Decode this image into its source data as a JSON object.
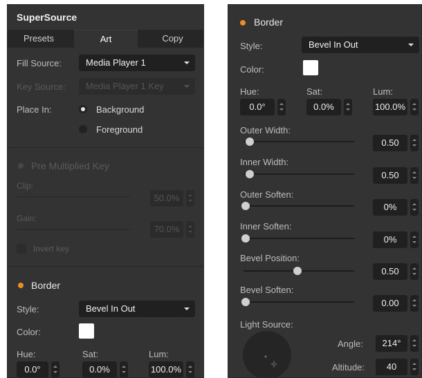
{
  "left_panel": {
    "title": "SuperSource",
    "tabs": [
      "Presets",
      "Art",
      "Copy"
    ],
    "active_tab": "Art",
    "fill_source": {
      "label": "Fill Source:",
      "value": "Media Player 1"
    },
    "key_source": {
      "label": "Key Source:",
      "value": "Media Player 1 Key"
    },
    "place_in": {
      "label": "Place In:",
      "options": [
        "Background",
        "Foreground"
      ],
      "selected": "Background"
    },
    "pre_multiplied_key": {
      "title": "Pre Multiplied Key",
      "clip": {
        "label": "Clip:",
        "value": "50.0%",
        "level": 0.5
      },
      "gain": {
        "label": "Gain:",
        "value": "70.0%",
        "level": 0.7
      },
      "invert_key": "Invert key"
    },
    "border": {
      "title": "Border",
      "style": {
        "label": "Style:",
        "value": "Bevel In Out"
      },
      "color": {
        "label": "Color:",
        "swatch": "#ffffff"
      },
      "hue": {
        "label": "Hue:",
        "value": "0.0°"
      },
      "sat": {
        "label": "Sat:",
        "value": "0.0%"
      },
      "lum": {
        "label": "Lum:",
        "value": "100.0%"
      }
    }
  },
  "right_panel": {
    "border": {
      "title": "Border",
      "style": {
        "label": "Style:",
        "value": "Bevel In Out"
      },
      "color": {
        "label": "Color:",
        "swatch": "#ffffff"
      },
      "hue": {
        "label": "Hue:",
        "value": "0.0°"
      },
      "sat": {
        "label": "Sat:",
        "value": "0.0%"
      },
      "lum": {
        "label": "Lum:",
        "value": "100.0%"
      },
      "outer_width": {
        "label": "Outer Width:",
        "value": "0.50",
        "level": 0.05
      },
      "inner_width": {
        "label": "Inner Width:",
        "value": "0.50",
        "level": 0.05
      },
      "outer_soften": {
        "label": "Outer Soften:",
        "value": "0%",
        "level": 0.0
      },
      "inner_soften": {
        "label": "Inner Soften:",
        "value": "0%",
        "level": 0.0
      },
      "bevel_position": {
        "label": "Bevel Position:",
        "value": "0.50",
        "level": 0.5
      },
      "bevel_soften": {
        "label": "Bevel Soften:",
        "value": "0.00",
        "level": 0.0
      },
      "light_source": {
        "label": "Light Source:",
        "angle": {
          "label": "Angle:",
          "value": "214°"
        },
        "altitude": {
          "label": "Altitude:",
          "value": "40"
        }
      }
    }
  },
  "colors": {
    "accent": "#f08a24",
    "panel_bg": "#333333",
    "field_bg": "#202020"
  }
}
